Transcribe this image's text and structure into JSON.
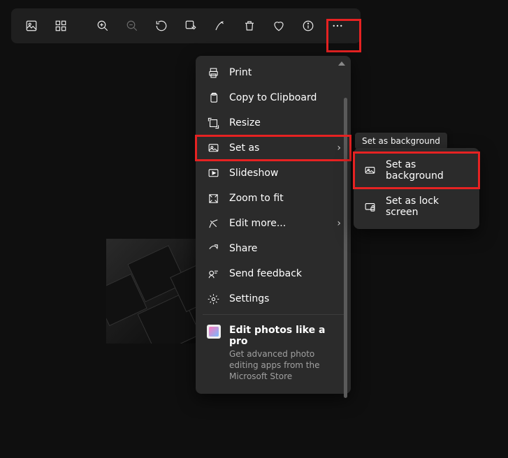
{
  "toolbar": {
    "buttons": [
      {
        "name": "view-photo-icon"
      },
      {
        "name": "filmstrip-icon"
      },
      {
        "name": "zoom-in-icon"
      },
      {
        "name": "zoom-out-icon"
      },
      {
        "name": "rotate-icon"
      },
      {
        "name": "edit-image-icon"
      },
      {
        "name": "markup-icon"
      },
      {
        "name": "delete-icon"
      },
      {
        "name": "favorite-icon"
      },
      {
        "name": "info-icon"
      },
      {
        "name": "more-icon"
      }
    ]
  },
  "menu": {
    "print": "Print",
    "copy": "Copy to Clipboard",
    "resize": "Resize",
    "setas": "Set as",
    "slideshow": "Slideshow",
    "zoomfit": "Zoom to fit",
    "editmore": "Edit more...",
    "share": "Share",
    "feedback": "Send feedback",
    "settings": "Settings",
    "promo_title": "Edit photos like a pro",
    "promo_sub": "Get advanced photo editing apps from the Microsoft Store"
  },
  "submenu": {
    "tooltip": "Set as background",
    "bg": "Set as background",
    "lock": "Set as lock screen"
  }
}
